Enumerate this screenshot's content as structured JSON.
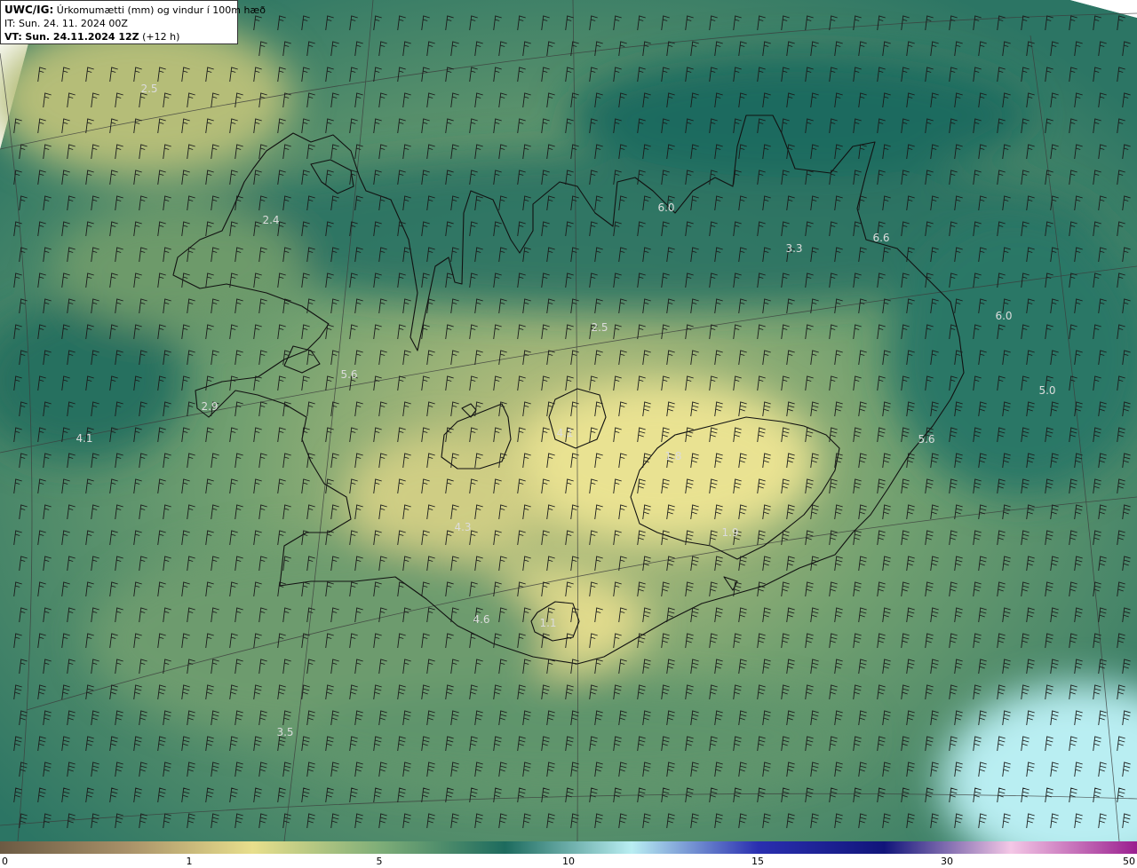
{
  "header": {
    "code": "UWC/IG:",
    "title": "Úrkomumætti (mm) og vindur í 100m hæð",
    "it_label": "IT:",
    "it_value": "Sun. 24. 11. 2024 00Z",
    "vt_label": "VT:",
    "vt_value": "Sun. 24.11.2024 12Z",
    "vt_offset": "(+12 h)"
  },
  "colorbar": {
    "ticks": [
      "0",
      "1",
      "5",
      "10",
      "15",
      "30",
      "50"
    ],
    "stops": [
      {
        "color": "#6b5a43"
      },
      {
        "color": "#a89068"
      },
      {
        "color": "#e8df8c"
      },
      {
        "color": "#7fae78"
      },
      {
        "color": "#1d6b5e"
      },
      {
        "color": "#b9eef2"
      },
      {
        "color": "#2a2fb0"
      },
      {
        "color": "#11157a"
      },
      {
        "color": "#f4c7e6"
      },
      {
        "color": "#9a1f8f"
      }
    ]
  },
  "map_labels": [
    {
      "text": "2.5"
    },
    {
      "text": "2.4"
    },
    {
      "text": "6.0"
    },
    {
      "text": "3.3"
    },
    {
      "text": "6.6"
    },
    {
      "text": "6.0"
    },
    {
      "text": "2.5"
    },
    {
      "text": "5.6"
    },
    {
      "text": "5.0"
    },
    {
      "text": "2.9"
    },
    {
      "text": "4.1"
    },
    {
      "text": "5.6"
    },
    {
      "text": "4.1"
    },
    {
      "text": "1.8"
    },
    {
      "text": "4.3"
    },
    {
      "text": "1.9"
    },
    {
      "text": "4.6"
    },
    {
      "text": "1.1"
    },
    {
      "text": "3.5"
    }
  ],
  "colors": {
    "sea": "#2e7a68",
    "dry": "#e6df8e",
    "moist": "#1f6e60",
    "coast": "#111111",
    "barb": "#1a1a1a",
    "grid": "#3c3c3c"
  }
}
